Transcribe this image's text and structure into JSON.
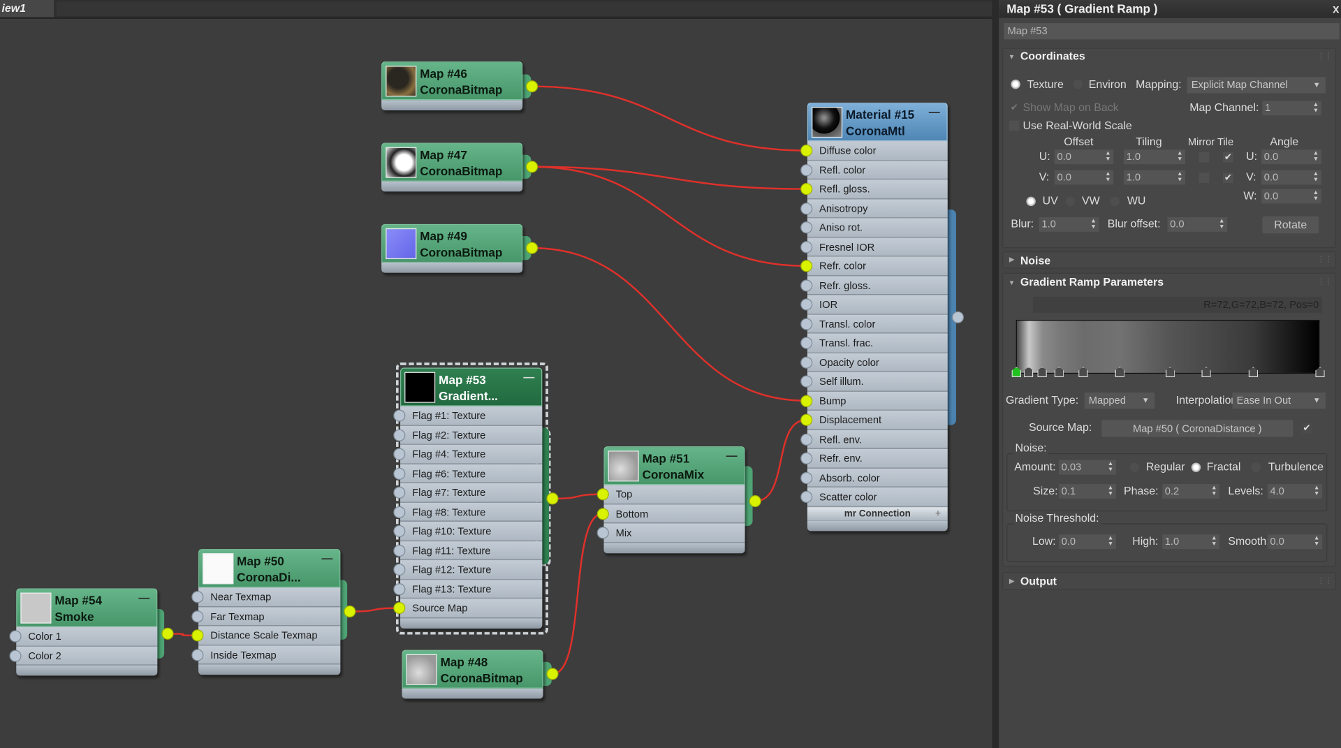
{
  "view_tab": "iew1",
  "nodes": {
    "map46": {
      "title": "Map #46",
      "type": "CoronaBitmap",
      "slots": []
    },
    "map47": {
      "title": "Map #47",
      "type": "CoronaBitmap",
      "slots": []
    },
    "map49": {
      "title": "Map #49",
      "type": "CoronaBitmap",
      "slots": []
    },
    "mat15": {
      "title": "Material #15",
      "type": "CoronaMtl",
      "slots": [
        "Diffuse color",
        "Refl. color",
        "Refl. gloss.",
        "Anisotropy",
        "Aniso rot.",
        "Fresnel IOR",
        "Refr. color",
        "Refr. gloss.",
        "IOR",
        "Transl. color",
        "Transl. frac.",
        "Opacity color",
        "Self illum.",
        "Bump",
        "Displacement",
        "Refl. env.",
        "Refr. env.",
        "Absorb. color",
        "Scatter color"
      ],
      "footer": "mr Connection",
      "footer_icon": "+"
    },
    "map53": {
      "title": "Map #53",
      "type": "Gradient...",
      "slots": [
        "Flag #1: Texture",
        "Flag #2: Texture",
        "Flag #4: Texture",
        "Flag #6: Texture",
        "Flag #7: Texture",
        "Flag #8: Texture",
        "Flag #10: Texture",
        "Flag #11: Texture",
        "Flag #12: Texture",
        "Flag #13: Texture",
        "Source Map"
      ]
    },
    "map51": {
      "title": "Map #51",
      "type": "CoronaMix",
      "slots": [
        "Top",
        "Bottom",
        "Mix"
      ]
    },
    "map48": {
      "title": "Map #48",
      "type": "CoronaBitmap",
      "slots": []
    },
    "map50": {
      "title": "Map #50",
      "type": "CoronaDi...",
      "slots": [
        "Near Texmap",
        "Far Texmap",
        "Distance Scale Texmap",
        "Inside Texmap"
      ]
    },
    "map54": {
      "title": "Map #54",
      "type": "Smoke",
      "slots": [
        "Color 1",
        "Color 2"
      ]
    }
  },
  "connections": [
    {
      "from": "map46",
      "to": "mat15",
      "slot": "Diffuse color"
    },
    {
      "from": "map47",
      "to": "mat15",
      "slot": "Refl. gloss."
    },
    {
      "from": "map47",
      "to": "mat15",
      "slot": "Refr. color"
    },
    {
      "from": "map49",
      "to": "mat15",
      "slot": "Bump"
    },
    {
      "from": "map51",
      "to": "mat15",
      "slot": "Displacement"
    },
    {
      "from": "map53",
      "to": "map51",
      "slot": "Top"
    },
    {
      "from": "map48",
      "to": "map51",
      "slot": "Bottom"
    },
    {
      "from": "map50",
      "to": "map53",
      "slot": "Source Map"
    },
    {
      "from": "map54",
      "to": "map50",
      "slot": "Distance Scale Texmap"
    }
  ],
  "wire_color": "#e0302a",
  "panel": {
    "title": "Map #53  ( Gradient Ramp )",
    "close": "x",
    "name": "Map #53",
    "coords": {
      "header": "Coordinates",
      "texture": "Texture",
      "environ": "Environ",
      "mapping_label": "Mapping:",
      "mapping": "Explicit Map Channel",
      "show_back": "Show Map on Back",
      "map_channel_label": "Map Channel:",
      "map_channel": "1",
      "real_world": "Use Real-World Scale",
      "h_offset": "Offset",
      "h_tiling": "Tiling",
      "h_mirror_tile": "Mirror Tile",
      "h_angle": "Angle",
      "u": "U:",
      "v": "V:",
      "w": "W:",
      "offset_u": "0.0",
      "offset_v": "0.0",
      "tiling_u": "1.0",
      "tiling_v": "1.0",
      "angle_u": "0.0",
      "angle_v": "0.0",
      "angle_w": "0.0",
      "mirror_u": false,
      "mirror_v": false,
      "tile_u": true,
      "tile_v": true,
      "uv": "UV",
      "vw": "VW",
      "wu": "WU",
      "blur_label": "Blur:",
      "blur": "1.0",
      "blur_offset_label": "Blur offset:",
      "blur_offset": "0.0",
      "rotate": "Rotate"
    },
    "noise_rollout": "Noise",
    "gradient": {
      "header": "Gradient Ramp Parameters",
      "readout": "R=72,G=72,B=72, Pos=0",
      "flags": [
        {
          "pos": 0,
          "color": "#484848",
          "selected": true
        },
        {
          "pos": 4,
          "color": "#c8c8c8"
        },
        {
          "pos": 8.5,
          "color": "#8a8a8a"
        },
        {
          "pos": 14,
          "color": "#7a7a7a"
        },
        {
          "pos": 22,
          "color": "#6c6c6c"
        },
        {
          "pos": 34,
          "color": "#727272"
        },
        {
          "pos": 50.6,
          "color": "#555555"
        },
        {
          "pos": 62.5,
          "color": "#4a4a4a"
        },
        {
          "pos": 78,
          "color": "#3a3a3a"
        },
        {
          "pos": 100,
          "color": "#000000"
        }
      ],
      "type_label": "Gradient Type:",
      "type": "Mapped",
      "interp_label": "Interpolation:",
      "interp": "Ease In Out",
      "source_label": "Source Map:",
      "source": "Map #50  ( CoronaDistance )",
      "source_enabled": true,
      "noise_label": "Noise:",
      "amount_label": "Amount:",
      "amount": "0.03",
      "regular": "Regular",
      "fractal": "Fractal",
      "turbulence": "Turbulence",
      "noise_type": "Fractal",
      "size_label": "Size:",
      "size": "0.1",
      "phase_label": "Phase:",
      "phase": "0.2",
      "levels_label": "Levels:",
      "levels": "4.0",
      "threshold_label": "Noise Threshold:",
      "low_label": "Low:",
      "low": "0.0",
      "high_label": "High:",
      "high": "1.0",
      "smooth_label": "Smooth:",
      "smooth": "0.0"
    },
    "output_rollout": "Output"
  }
}
